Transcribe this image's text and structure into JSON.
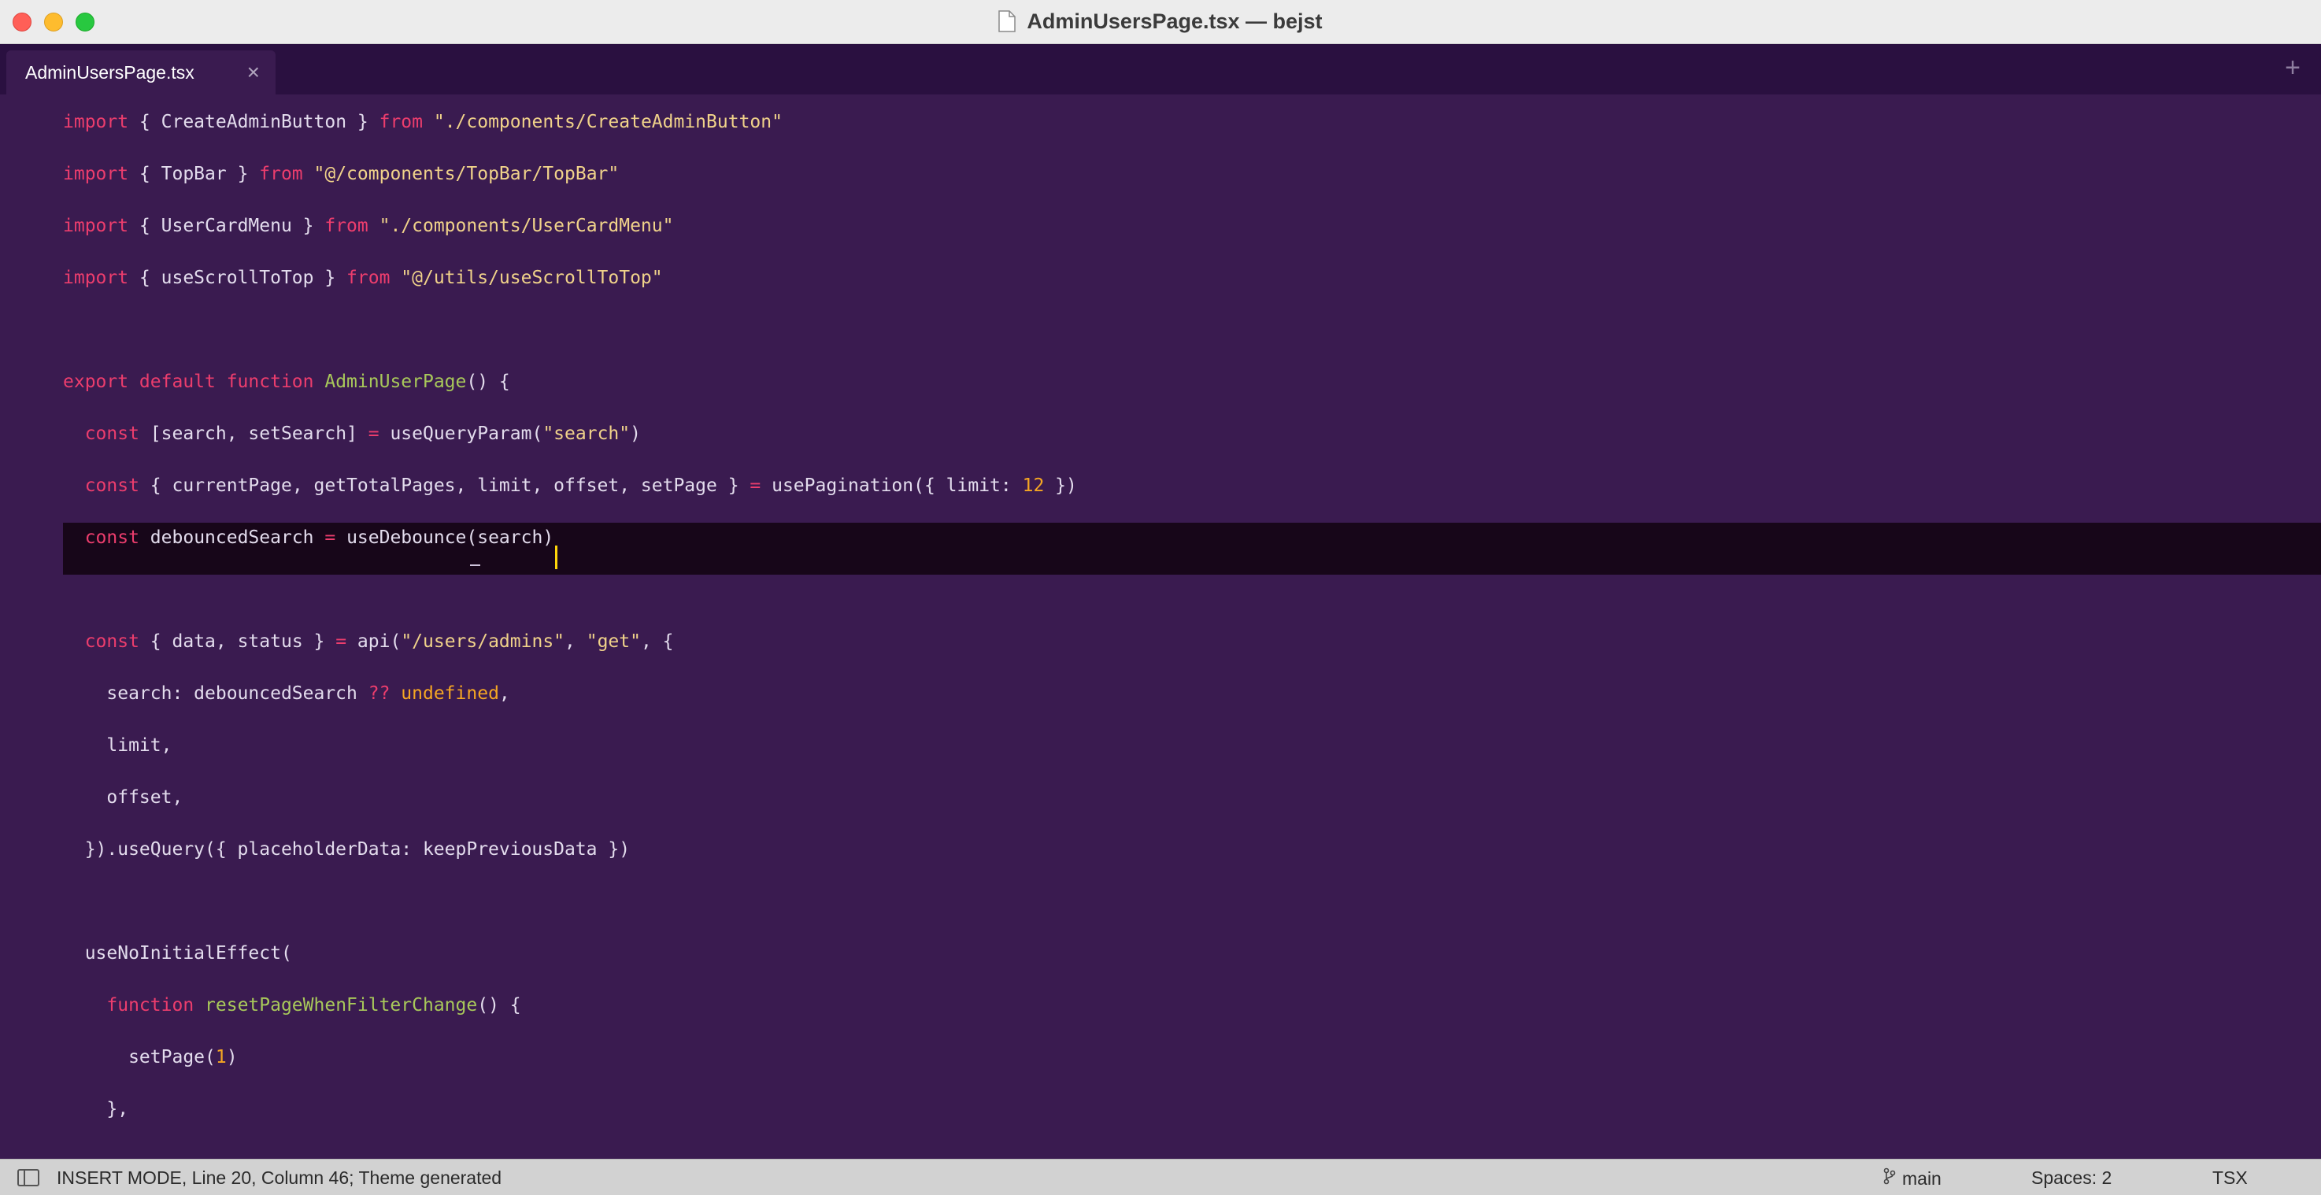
{
  "window": {
    "title": "AdminUsersPage.tsx — bejst"
  },
  "tabs": [
    {
      "label": "AdminUsersPage.tsx",
      "close": "×"
    }
  ],
  "tabbar": {
    "new_tab": "+"
  },
  "editor": {
    "lines": [
      {
        "tokens": [
          [
            "kw",
            "import"
          ],
          [
            "p",
            " { CreateAdminButton } "
          ],
          [
            "kw",
            "from"
          ],
          [
            "p",
            " "
          ],
          [
            "str",
            "\"./components/CreateAdminButton\""
          ]
        ]
      },
      {
        "tokens": [
          [
            "kw",
            "import"
          ],
          [
            "p",
            " { TopBar } "
          ],
          [
            "kw",
            "from"
          ],
          [
            "p",
            " "
          ],
          [
            "str",
            "\"@/components/TopBar/TopBar\""
          ]
        ]
      },
      {
        "tokens": [
          [
            "kw",
            "import"
          ],
          [
            "p",
            " { UserCardMenu } "
          ],
          [
            "kw",
            "from"
          ],
          [
            "p",
            " "
          ],
          [
            "str",
            "\"./components/UserCardMenu\""
          ]
        ]
      },
      {
        "tokens": [
          [
            "kw",
            "import"
          ],
          [
            "p",
            " { useScrollToTop } "
          ],
          [
            "kw",
            "from"
          ],
          [
            "p",
            " "
          ],
          [
            "str",
            "\"@/utils/useScrollToTop\""
          ]
        ]
      },
      {
        "tokens": []
      },
      {
        "tokens": [
          [
            "kw",
            "export default function"
          ],
          [
            "p",
            " "
          ],
          [
            "fn",
            "AdminUserPage"
          ],
          [
            "p",
            "() {"
          ]
        ]
      },
      {
        "tokens": [
          [
            "p",
            "  "
          ],
          [
            "kw",
            "const"
          ],
          [
            "p",
            " [search, setSearch] "
          ],
          [
            "kw",
            "="
          ],
          [
            "p",
            " useQueryParam("
          ],
          [
            "str",
            "\"search\""
          ],
          [
            "p",
            ")"
          ]
        ]
      },
      {
        "tokens": [
          [
            "p",
            "  "
          ],
          [
            "kw",
            "const"
          ],
          [
            "p",
            " { currentPage, getTotalPages, limit, offset, setPage } "
          ],
          [
            "kw",
            "="
          ],
          [
            "p",
            " usePagination({ limit: "
          ],
          [
            "num",
            "12"
          ],
          [
            "p",
            " })"
          ]
        ]
      },
      {
        "tokens": [
          [
            "p",
            "  "
          ],
          [
            "kw",
            "const"
          ],
          [
            "p",
            " debouncedSearch "
          ],
          [
            "kw",
            "="
          ],
          [
            "p",
            " useDebounce(search)"
          ]
        ]
      },
      {
        "tokens": []
      },
      {
        "tokens": [
          [
            "p",
            "  "
          ],
          [
            "kw",
            "const"
          ],
          [
            "p",
            " { data, status } "
          ],
          [
            "kw",
            "="
          ],
          [
            "p",
            " api("
          ],
          [
            "str",
            "\"/users/admins\""
          ],
          [
            "p",
            ", "
          ],
          [
            "str",
            "\"get\""
          ],
          [
            "p",
            ", {"
          ]
        ]
      },
      {
        "tokens": [
          [
            "p",
            "    search: debouncedSearch "
          ],
          [
            "kw",
            "??"
          ],
          [
            "p",
            " "
          ],
          [
            "und",
            "undefined"
          ],
          [
            "p",
            ","
          ]
        ]
      },
      {
        "tokens": [
          [
            "p",
            "    limit,"
          ]
        ]
      },
      {
        "tokens": [
          [
            "p",
            "    offset,"
          ]
        ]
      },
      {
        "tokens": [
          [
            "p",
            "  }).useQuery({ placeholderData: keepPreviousData })"
          ]
        ]
      },
      {
        "tokens": []
      },
      {
        "tokens": [
          [
            "p",
            "  useNoInitialEffect("
          ]
        ]
      },
      {
        "tokens": [
          [
            "p",
            "    "
          ],
          [
            "kw",
            "function"
          ],
          [
            "p",
            " "
          ],
          [
            "fn",
            "resetPageWhenFilterChange"
          ],
          [
            "p",
            "() {"
          ]
        ]
      },
      {
        "tokens": [
          [
            "p",
            "      setPage("
          ],
          [
            "num",
            "1"
          ],
          [
            "p",
            ")"
          ]
        ]
      },
      {
        "tokens": [
          [
            "p",
            "    },"
          ]
        ]
      }
    ]
  },
  "statusbar": {
    "mode": "INSERT MODE, Line 20, Column 46; Theme generated",
    "branch": "main",
    "spaces": "Spaces: 2",
    "syntax": "TSX"
  }
}
